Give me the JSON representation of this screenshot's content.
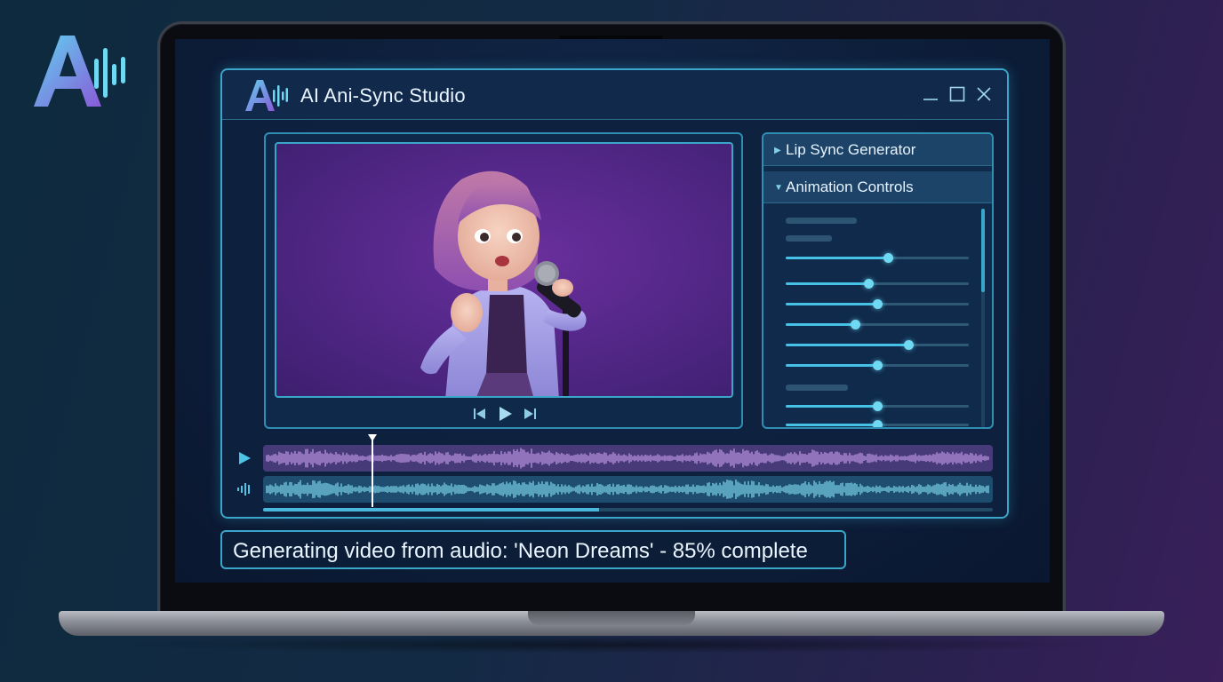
{
  "brand": {
    "logo_icon": "ai-waveform-logo-icon"
  },
  "app": {
    "title": "AI Ani-Sync Studio",
    "window_controls": [
      "minimize-icon",
      "maximize-icon",
      "close-icon"
    ]
  },
  "preview": {
    "content": "singing-avatar-illustration",
    "controls": [
      "skip-back-icon",
      "play-icon",
      "skip-forward-icon"
    ]
  },
  "side_panel": {
    "sections": [
      {
        "label": "Lip Sync Generator",
        "expanded": false
      },
      {
        "label": "Animation Controls",
        "expanded": true
      }
    ],
    "sliders": [
      0.56,
      0.45,
      0.5,
      0.38,
      0.67,
      0.5,
      0.5,
      0.5
    ]
  },
  "timeline": {
    "tracks": [
      {
        "icon": "play-track-icon",
        "color": "#9b6bd6"
      },
      {
        "icon": "audio-wave-icon",
        "color": "#4fc3e6"
      }
    ],
    "playhead_fraction": 0.15,
    "progress_fraction": 0.46
  },
  "status": {
    "text": "Generating video from audio: 'Neon Dreams' - 85% complete",
    "progress_percent": 85
  },
  "colors": {
    "accent": "#3aa6c9",
    "purple": "#6a2f9c",
    "bg": "#0d1e3a"
  }
}
